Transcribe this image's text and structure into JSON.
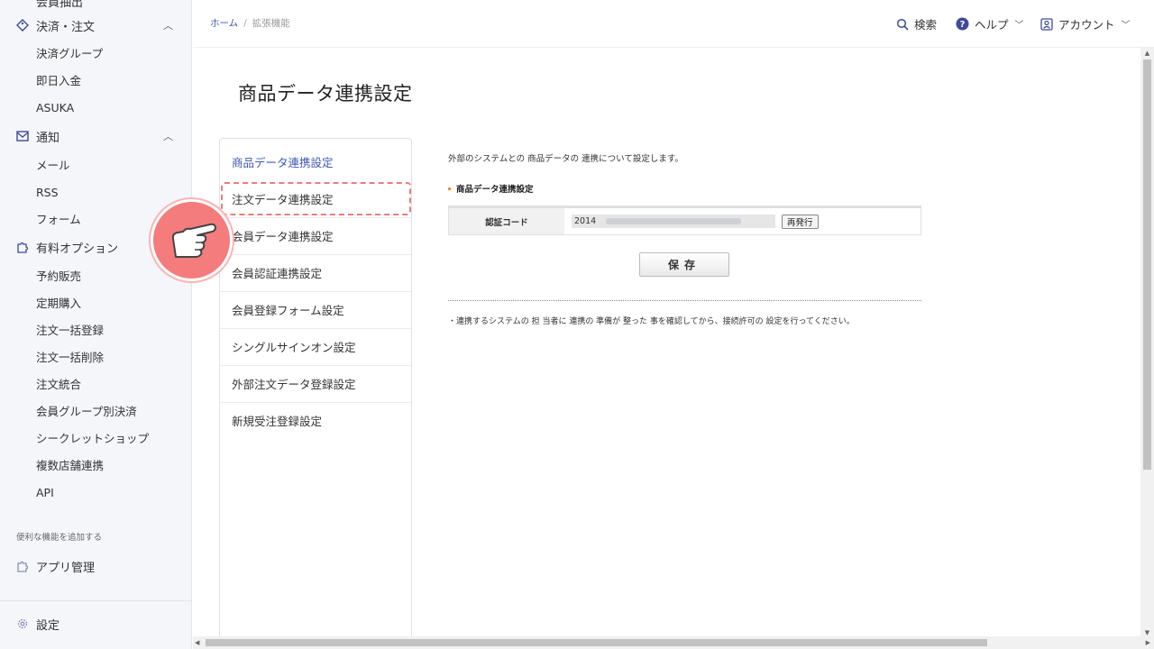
{
  "sidebar": {
    "cut_item": "会員抽出",
    "groups": [
      {
        "label": "決済・注文",
        "icon": "tag-icon",
        "items": [
          "決済グループ",
          "即日入金",
          "ASUKA"
        ]
      },
      {
        "label": "通知",
        "icon": "mail-icon",
        "items": [
          "メール",
          "RSS",
          "フォーム"
        ]
      },
      {
        "label": "有料オプション",
        "icon": "puzzle-icon",
        "items": [
          "予約販売",
          "定期購入",
          "注文一括登録",
          "注文一括削除",
          "注文統合",
          "会員グループ別決済",
          "シークレットショップ",
          "複数店舗連携",
          "API"
        ]
      }
    ],
    "note": "便利な機能を追加する",
    "app_manage": "アプリ管理",
    "settings": "設定"
  },
  "header": {
    "breadcrumb_home": "ホーム",
    "breadcrumb_sep": "/",
    "breadcrumb_current": "拡張機能",
    "search": "検索",
    "help": "ヘルプ",
    "account": "アカウント"
  },
  "page": {
    "title": "商品データ連携設定"
  },
  "subnav": [
    "商品データ連携設定",
    "注文データ連携設定",
    "会員データ連携設定",
    "会員認証連携設定",
    "会員登録フォーム設定",
    "シングルサインオン設定",
    "外部注文データ登録設定",
    "新規受注登録設定"
  ],
  "content": {
    "description": "外部のシステムとの 商品データの 連携について設定します。",
    "section_title": "商品データ連携設定",
    "auth_label": "認証コード",
    "auth_code_prefix": "2014",
    "reissue": "再発行",
    "save": "保存",
    "note": "・連携するシステムの 担 当者に 連携の 準備が 整った 事を確認してから、接続許可の 設定を行ってください。"
  },
  "colors": {
    "accent": "#3d57b4",
    "highlight": "#ef7b7b",
    "pointer_bg": "#f47c7c",
    "section_mark": "#f08a24"
  }
}
